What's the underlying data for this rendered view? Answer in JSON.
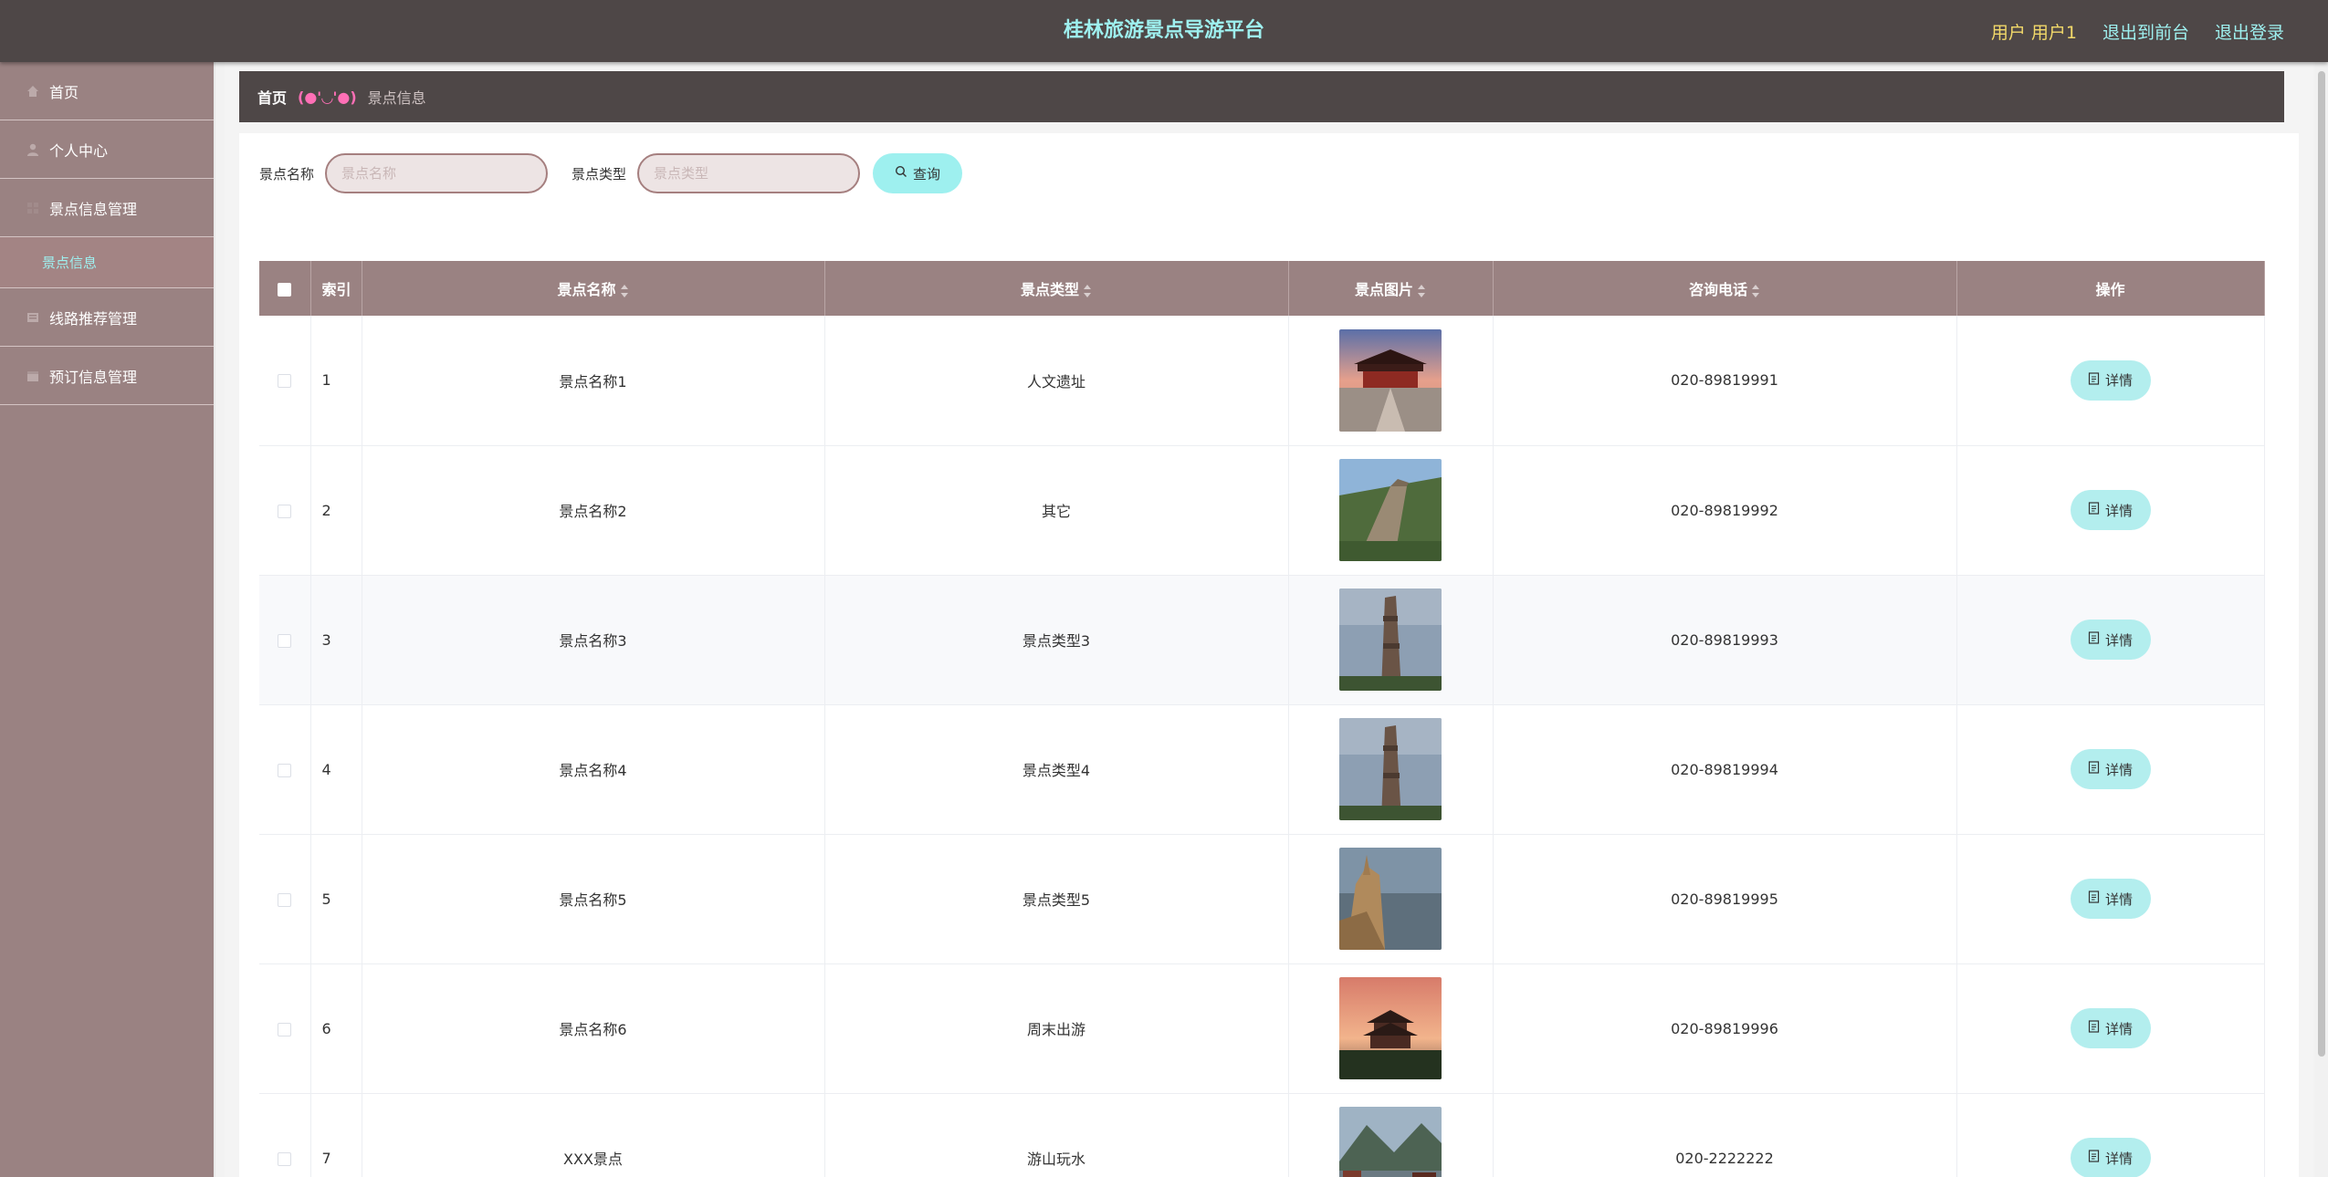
{
  "header": {
    "title": "桂林旅游景点导游平台",
    "user_label": "用户 用户1",
    "front_link": "退出到前台",
    "logout_link": "退出登录"
  },
  "sidebar": {
    "items": [
      {
        "label": "首页",
        "icon": "home-icon"
      },
      {
        "label": "个人中心",
        "icon": "user-icon"
      },
      {
        "label": "景点信息管理",
        "icon": "grid-icon"
      },
      {
        "label": "线路推荐管理",
        "icon": "list-icon"
      },
      {
        "label": "预订信息管理",
        "icon": "calendar-icon"
      }
    ],
    "sub_item": "景点信息"
  },
  "breadcrumb": {
    "home": "首页",
    "separator": "(●'◡'●)",
    "current": "景点信息"
  },
  "search": {
    "name_label": "景点名称",
    "name_placeholder": "景点名称",
    "type_label": "景点类型",
    "type_placeholder": "景点类型",
    "query_button": "查询"
  },
  "table": {
    "headers": [
      "索引",
      "景点名称",
      "景点类型",
      "景点图片",
      "咨询电话",
      "操作"
    ],
    "detail_label": "详情",
    "rows": [
      {
        "index": "1",
        "name": "景点名称1",
        "type": "人文遗址",
        "phone": "020-89819991",
        "thumb": "palace"
      },
      {
        "index": "2",
        "name": "景点名称2",
        "type": "其它",
        "phone": "020-89819992",
        "thumb": "wall"
      },
      {
        "index": "3",
        "name": "景点名称3",
        "type": "景点类型3",
        "phone": "020-89819993",
        "thumb": "pillar"
      },
      {
        "index": "4",
        "name": "景点名称4",
        "type": "景点类型4",
        "phone": "020-89819994",
        "thumb": "pillar"
      },
      {
        "index": "5",
        "name": "景点名称5",
        "type": "景点类型5",
        "phone": "020-89819995",
        "thumb": "cliff"
      },
      {
        "index": "6",
        "name": "景点名称6",
        "type": "周末出游",
        "phone": "020-89819996",
        "thumb": "pagoda"
      },
      {
        "index": "7",
        "name": "XXX景点",
        "type": "游山玩水",
        "phone": "020-2222222",
        "thumb": "town"
      }
    ]
  },
  "colors": {
    "topbar": "#4e4747",
    "accent": "#9ef0ef",
    "sidebar": "#9a8282",
    "user_highlight": "#f2d96a"
  }
}
